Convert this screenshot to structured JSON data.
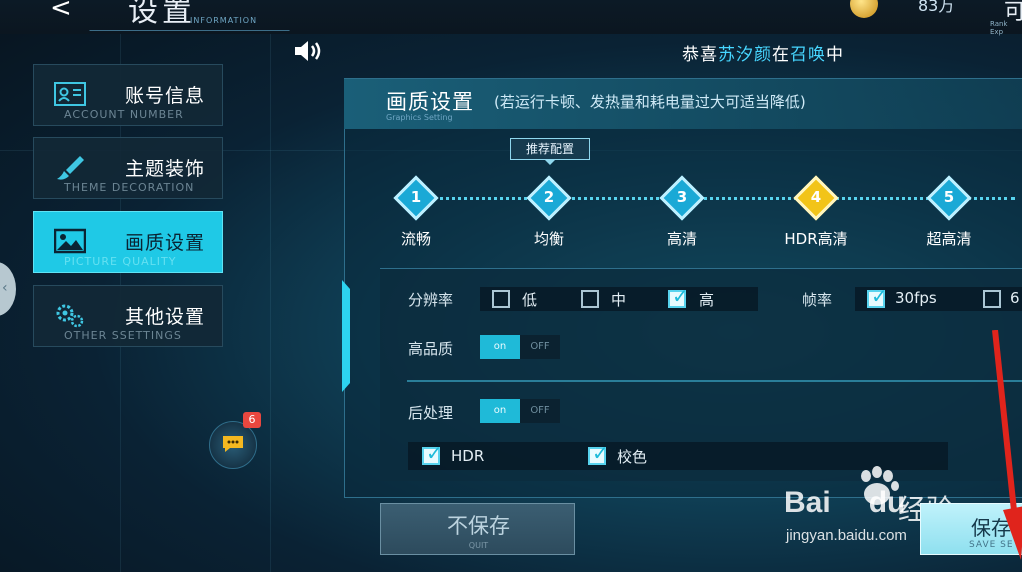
{
  "header": {
    "back_glyph": "<",
    "title": "设置",
    "title_en": "INFORMATION",
    "power_value": "83万",
    "top_right_glyph": "可",
    "top_right_small": "Rank Exp"
  },
  "notice": {
    "prefix": "恭喜",
    "name": "苏汐颜",
    "middle": "在",
    "event": "召唤",
    "suffix": "中"
  },
  "menu": [
    {
      "label": "账号信息",
      "en": "ACCOUNT NUMBER",
      "icon": "id-card-icon",
      "active": false
    },
    {
      "label": "主题装饰",
      "en": "THEME DECORATION",
      "icon": "brush-icon",
      "active": false
    },
    {
      "label": "画质设置",
      "en": "PICTURE QUALITY",
      "icon": "image-icon",
      "active": true
    },
    {
      "label": "其他设置",
      "en": "OTHER SSETTINGS",
      "icon": "gears-icon",
      "active": false
    }
  ],
  "chat": {
    "badge": "6"
  },
  "panel": {
    "title": "画质设置",
    "note": "(若运行卡顿、发热量和耗电量过大可适当降低)",
    "title_en": "Graphics Setting",
    "recommend_tag": "推荐配置",
    "presets": [
      {
        "num": "1",
        "label": "流畅",
        "selected": false
      },
      {
        "num": "2",
        "label": "均衡",
        "selected": false
      },
      {
        "num": "3",
        "label": "高清",
        "selected": false
      },
      {
        "num": "4",
        "label": "HDR高清",
        "selected": true
      },
      {
        "num": "5",
        "label": "超高清",
        "selected": false
      }
    ]
  },
  "settings": {
    "resolution": {
      "label": "分辨率",
      "options": [
        "低",
        "中",
        "高"
      ],
      "checked": "高"
    },
    "framerate": {
      "label": "帧率",
      "options": [
        "30fps",
        "6"
      ],
      "checked": "30fps"
    },
    "high_quality": {
      "label": "高品质",
      "on": "on",
      "off": "OFF",
      "state": "on"
    },
    "post_process": {
      "label": "后处理",
      "on": "on",
      "off": "OFF",
      "state": "on"
    },
    "post_options": [
      {
        "label": "HDR",
        "checked": true
      },
      {
        "label": "校色",
        "checked": true
      }
    ]
  },
  "buttons": {
    "quit_label": "不保存",
    "quit_en": "QUIT",
    "save_label": "保存设",
    "save_en": "SAVE SE"
  },
  "watermark": {
    "brand": "Bai",
    "brand2": "du",
    "cn": "经验",
    "url": "jingyan.baidu.com"
  },
  "colors": {
    "accent": "#1fc9e6",
    "selected_preset": "#f2c418",
    "arrow": "#e0241c"
  }
}
